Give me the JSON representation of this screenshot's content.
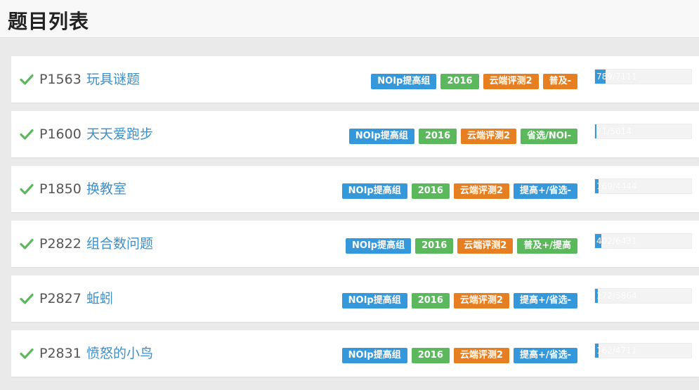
{
  "header": {
    "title": "题目列表"
  },
  "colors": {
    "blue": "#3498db",
    "green": "#5cb85c",
    "orange": "#e67e22",
    "check": "#5cb85c",
    "link": "#3d8fc7"
  },
  "problems": [
    {
      "id": "P1563",
      "name": "玩具谜题",
      "solved": true,
      "tags": [
        {
          "label": "NOIp提高组",
          "color": "blue"
        },
        {
          "label": "2016",
          "color": "green"
        },
        {
          "label": "云端评测2",
          "color": "orange"
        },
        {
          "label": "普及-",
          "color": "orange"
        }
      ],
      "stats": "789/7111",
      "accepted": 789,
      "total": 7111
    },
    {
      "id": "P1600",
      "name": "天天爱跑步",
      "solved": true,
      "tags": [
        {
          "label": "NOIp提高组",
          "color": "blue"
        },
        {
          "label": "2016",
          "color": "green"
        },
        {
          "label": "云端评测2",
          "color": "orange"
        },
        {
          "label": "省选/NOI-",
          "color": "green"
        }
      ],
      "stats": "71/5014",
      "accepted": 71,
      "total": 5014
    },
    {
      "id": "P1850",
      "name": "换教室",
      "solved": true,
      "tags": [
        {
          "label": "NOIp提高组",
          "color": "blue"
        },
        {
          "label": "2016",
          "color": "green"
        },
        {
          "label": "云端评测2",
          "color": "orange"
        },
        {
          "label": "提高+/省选-",
          "color": "blue"
        }
      ],
      "stats": "169/4444",
      "accepted": 169,
      "total": 4444
    },
    {
      "id": "P2822",
      "name": "组合数问题",
      "solved": true,
      "tags": [
        {
          "label": "NOIp提高组",
          "color": "blue"
        },
        {
          "label": "2016",
          "color": "green"
        },
        {
          "label": "云端评测2",
          "color": "orange"
        },
        {
          "label": "普及+/提高",
          "color": "green"
        }
      ],
      "stats": "402/6431",
      "accepted": 402,
      "total": 6431
    },
    {
      "id": "P2827",
      "name": "蚯蚓",
      "solved": true,
      "tags": [
        {
          "label": "NOIp提高组",
          "color": "blue"
        },
        {
          "label": "2016",
          "color": "green"
        },
        {
          "label": "云端评测2",
          "color": "orange"
        },
        {
          "label": "提高+/省选-",
          "color": "blue"
        }
      ],
      "stats": "172/5864",
      "accepted": 172,
      "total": 5864
    },
    {
      "id": "P2831",
      "name": "愤怒的小鸟",
      "solved": true,
      "tags": [
        {
          "label": "NOIp提高组",
          "color": "blue"
        },
        {
          "label": "2016",
          "color": "green"
        },
        {
          "label": "云端评测2",
          "color": "orange"
        },
        {
          "label": "提高+/省选-",
          "color": "blue"
        }
      ],
      "stats": "162/4711",
      "accepted": 162,
      "total": 4711
    }
  ]
}
